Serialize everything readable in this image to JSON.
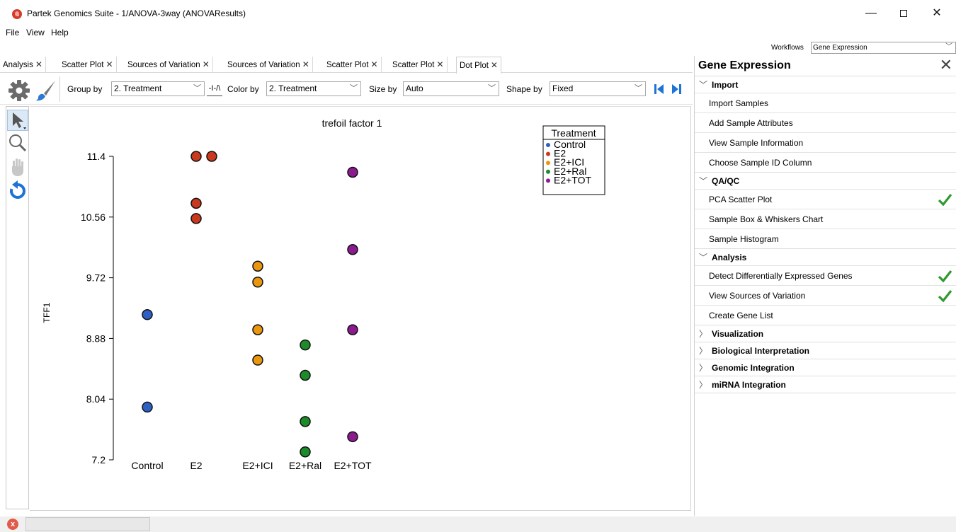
{
  "window": {
    "title": "Partek Genomics Suite - 1/ANOVA-3way (ANOVAResults)",
    "minimize": "—",
    "close": "✕"
  },
  "menu": [
    "File",
    "View",
    "Help"
  ],
  "workflows": {
    "label": "Workflows",
    "value": "Gene Expression"
  },
  "tabs": [
    {
      "label": "Analysis"
    },
    {
      "label": "Scatter Plot"
    },
    {
      "label": "Sources of Variation"
    },
    {
      "label": "Sources of Variation"
    },
    {
      "label": "Scatter Plot"
    },
    {
      "label": "Scatter Plot"
    },
    {
      "label": "Dot Plot",
      "active": true
    }
  ],
  "tab_close_glyph": "✕",
  "toolbar": {
    "group_by_label": "Group by",
    "group_by_value": "2. Treatment",
    "flip_label": "-I-/\\",
    "color_by_label": "Color by",
    "color_by_value": "2. Treatment",
    "size_by_label": "Size by",
    "size_by_value": "Auto",
    "shape_by_label": "Shape by",
    "shape_by_value": "Fixed"
  },
  "icons": {
    "settings": "gear-icon",
    "brush": "paintbrush-icon",
    "select": "pointer-icon",
    "zoom": "magnifier-icon",
    "pan": "hand-icon",
    "reset": "refresh-icon",
    "first": "skip-first-icon",
    "last": "skip-last-icon"
  },
  "chart_data": {
    "type": "scatter",
    "title": "trefoil factor 1",
    "ylabel": "TFF1",
    "xlabel": "",
    "categories": [
      "Control",
      "E2",
      "E2+ICI",
      "E2+Ral",
      "E2+TOT"
    ],
    "yticks": [
      "11.4",
      "10.56",
      "9.72",
      "8.88",
      "8.04",
      "7.2"
    ],
    "ylim": [
      7.2,
      11.4
    ],
    "legend": {
      "title": "Treatment",
      "position": "top-right",
      "entries": [
        "Control",
        "E2",
        "E2+ICI",
        "E2+Ral",
        "E2+TOT"
      ]
    },
    "colors": {
      "Control": "#2e5fc4",
      "E2": "#c9391d",
      "E2+ICI": "#e8970f",
      "E2+Ral": "#1c8c2a",
      "E2+TOT": "#8c1a8f"
    },
    "series": [
      {
        "name": "Control",
        "points": [
          {
            "x": 0,
            "y": 9.21
          },
          {
            "x": 0,
            "y": 7.93
          }
        ]
      },
      {
        "name": "E2",
        "points": [
          {
            "x": 0,
            "y": 11.4
          },
          {
            "x": 0.35,
            "y": 11.4
          },
          {
            "x": 0,
            "y": 10.75
          },
          {
            "x": 0,
            "y": 10.54
          }
        ]
      },
      {
        "name": "E2+ICI",
        "points": [
          {
            "x": 0,
            "y": 9.88
          },
          {
            "x": 0,
            "y": 9.66
          },
          {
            "x": 0,
            "y": 9.0
          },
          {
            "x": 0,
            "y": 8.58
          }
        ]
      },
      {
        "name": "E2+Ral",
        "points": [
          {
            "x": 0,
            "y": 8.79
          },
          {
            "x": 0,
            "y": 8.37
          },
          {
            "x": 0,
            "y": 7.73
          },
          {
            "x": 0,
            "y": 7.31
          }
        ]
      },
      {
        "name": "E2+TOT",
        "points": [
          {
            "x": 0,
            "y": 11.18
          },
          {
            "x": 0,
            "y": 10.11
          },
          {
            "x": 0,
            "y": 9.0
          },
          {
            "x": 0,
            "y": 7.52
          }
        ]
      }
    ],
    "grid": false
  },
  "right_panel": {
    "title": "Gene Expression",
    "close": "✕",
    "sections": [
      {
        "title": "Import",
        "expanded": true,
        "items": [
          {
            "label": "Import Samples",
            "done": false
          },
          {
            "label": "Add Sample Attributes",
            "done": false
          },
          {
            "label": "View Sample Information",
            "done": false
          },
          {
            "label": "Choose Sample ID Column",
            "done": false
          }
        ]
      },
      {
        "title": "QA/QC",
        "expanded": true,
        "items": [
          {
            "label": "PCA Scatter Plot",
            "done": true
          },
          {
            "label": "Sample Box & Whiskers Chart",
            "done": false
          },
          {
            "label": "Sample Histogram",
            "done": false
          }
        ]
      },
      {
        "title": "Analysis",
        "expanded": true,
        "items": [
          {
            "label": "Detect Differentially Expressed Genes",
            "done": true
          },
          {
            "label": "View Sources of Variation",
            "done": true
          },
          {
            "label": "Create Gene List",
            "done": false
          }
        ]
      },
      {
        "title": "Visualization",
        "expanded": false,
        "items": []
      },
      {
        "title": "Biological Interpretation",
        "expanded": false,
        "items": []
      },
      {
        "title": "Genomic Integration",
        "expanded": false,
        "items": []
      },
      {
        "title": "miRNA Integration",
        "expanded": false,
        "items": []
      }
    ]
  },
  "status": {
    "error_glyph": "x",
    "field_text": ""
  }
}
